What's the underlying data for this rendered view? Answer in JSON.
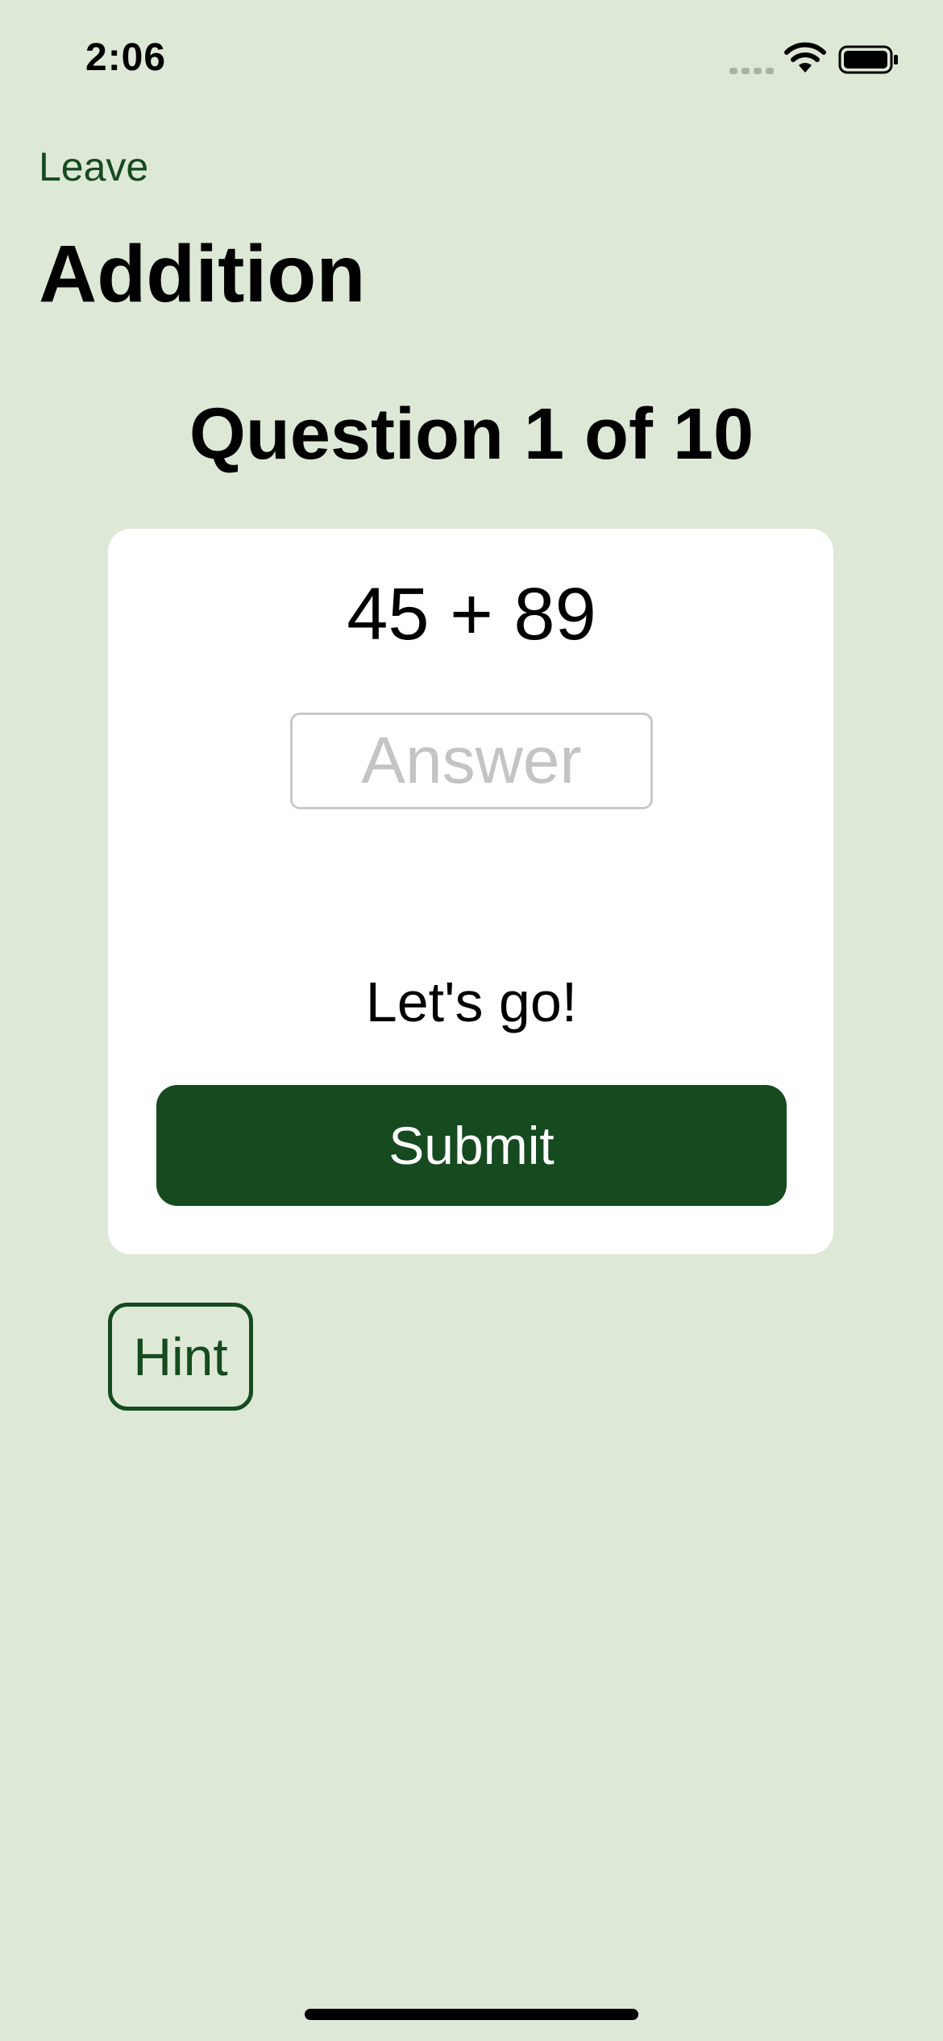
{
  "status_bar": {
    "time": "2:06",
    "icons": [
      "signal-icon",
      "wifi-icon",
      "battery-icon"
    ]
  },
  "navigation": {
    "leave_label": "Leave"
  },
  "page": {
    "title": "Addition",
    "question_counter": "Question 1 of 10"
  },
  "card": {
    "problem": "45 + 89",
    "answer": {
      "value": "",
      "placeholder": "Answer"
    },
    "feedback": "Let's go!",
    "submit_label": "Submit"
  },
  "hint_label": "Hint",
  "colors": {
    "background": "#dde9d6",
    "accent": "#164a1f",
    "card": "#ffffff",
    "placeholder": "#c4c4c4"
  }
}
